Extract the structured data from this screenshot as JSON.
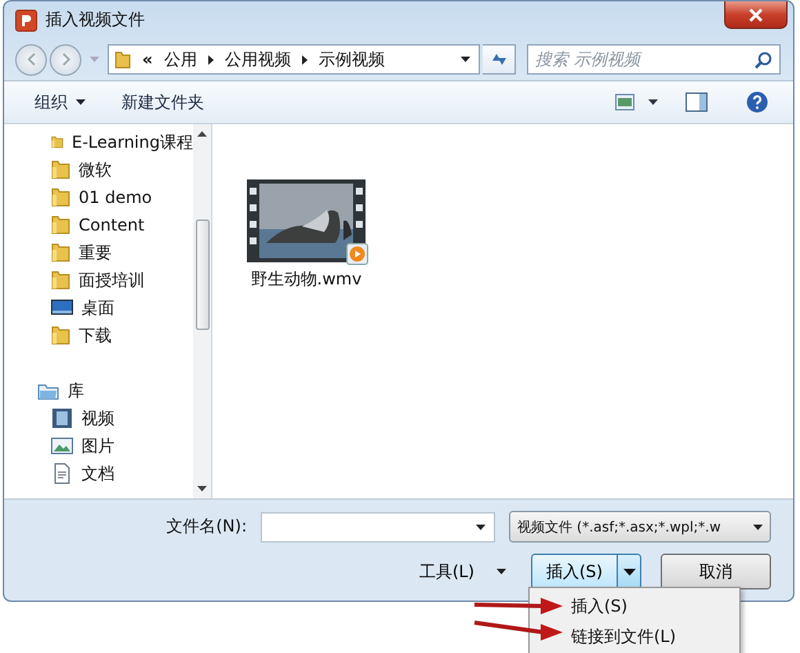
{
  "window": {
    "title": "插入视频文件"
  },
  "address": {
    "overflow": "«",
    "crumbs": [
      "公用",
      "公用视频",
      "示例视频"
    ]
  },
  "search": {
    "placeholder": "搜索 示例视频"
  },
  "toolbar": {
    "buttons": [
      {
        "label": "组织",
        "kind": "menu"
      },
      {
        "label": "新建文件夹",
        "kind": "plain"
      }
    ]
  },
  "sidebar": {
    "items": [
      {
        "label": "E-Learning课程",
        "kind": "folder"
      },
      {
        "label": "微软",
        "kind": "folder"
      },
      {
        "label": "01 demo",
        "kind": "folder"
      },
      {
        "label": "Content",
        "kind": "folder"
      },
      {
        "label": "重要",
        "kind": "folder"
      },
      {
        "label": "面授培训",
        "kind": "folder"
      },
      {
        "label": "桌面",
        "kind": "desktop"
      },
      {
        "label": "下载",
        "kind": "folder"
      },
      {
        "label": "库",
        "kind": "library"
      },
      {
        "label": "视频",
        "kind": "video"
      },
      {
        "label": "图片",
        "kind": "pictures"
      },
      {
        "label": "文档",
        "kind": "document"
      }
    ]
  },
  "files": [
    {
      "name": "野生动物.wmv",
      "kind": "picture"
    }
  ],
  "filename": {
    "label": "文件名(N):"
  },
  "filetype": {
    "value": "视频文件 (*.asf;*.asx;*.wpl;*.w"
  },
  "tools": {
    "label": "工具(L)"
  },
  "insert_button": {
    "label": "插入(S)"
  },
  "cancel_button": {
    "label": "取消"
  },
  "menu": {
    "items": [
      {
        "label": "插入(S)",
        "arrow": true
      },
      {
        "label": "链接到文件(L)",
        "arrow": true
      }
    ]
  }
}
